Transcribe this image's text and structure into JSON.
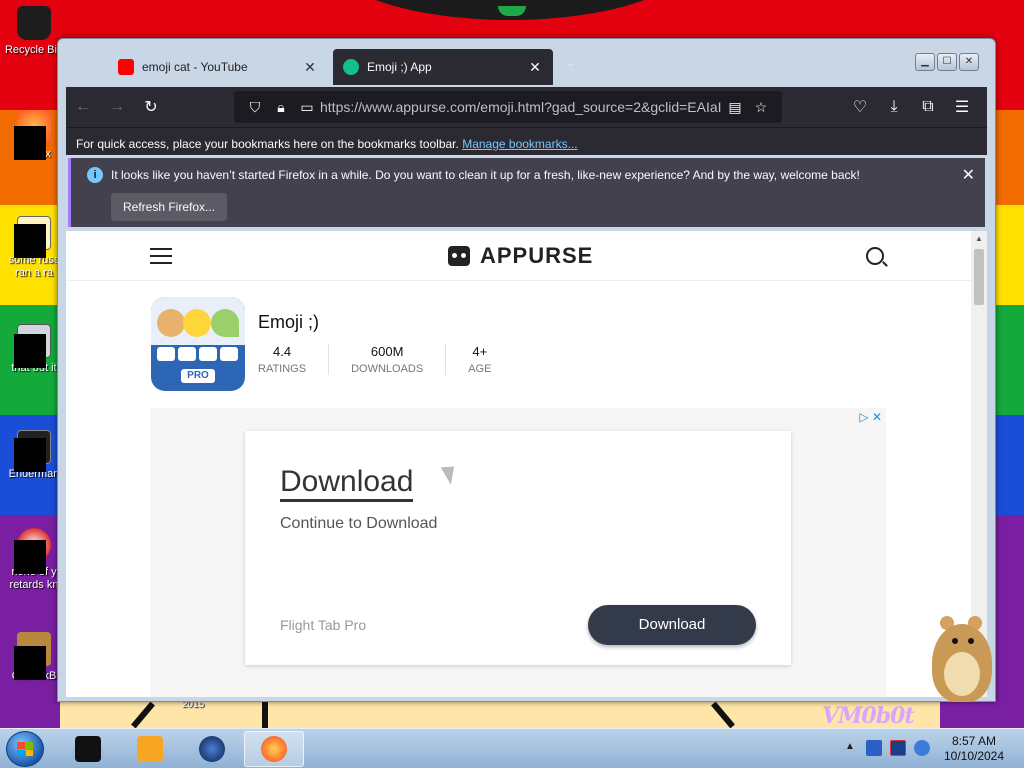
{
  "desktop": {
    "icons": [
      {
        "label": "Recycle Bin",
        "icon": "recycle-bin-icon"
      },
      {
        "label": "Firefox",
        "icon": "firefox-icon"
      },
      {
        "label": "some russ",
        "label2": "ran a ra",
        "icon": "document-icon"
      },
      {
        "label": "that but it",
        "icon": "folder-icon"
      },
      {
        "label": "Enderman",
        "icon": "console-icon"
      },
      {
        "label": "none of y",
        "label2": "retards kn",
        "icon": "browser-icon"
      },
      {
        "label": "ChomikB",
        "icon": "hamster-icon"
      }
    ],
    "wallpaper_year": "2015",
    "wallpaper_tag": "VM0b0t"
  },
  "browser": {
    "tabs": [
      {
        "title": "emoji cat - YouTube",
        "favicon": "youtube-icon",
        "favicon_color": "#ff0000"
      },
      {
        "title": "Emoji ;) App",
        "favicon": "appurse-icon",
        "favicon_color": "#13c08a",
        "active": true
      }
    ],
    "new_tab_label": "+",
    "url": "https://www.appurse.com/emoji.html?gad_source=2&gclid=EAIaI",
    "bookmarks_bar": {
      "text": "For quick access, place your bookmarks here on the bookmarks toolbar.",
      "link": "Manage bookmarks..."
    },
    "notification": {
      "message": "It looks like you haven’t started Firefox in a while. Do you want to clean it up for a fresh, like-new experience? And by the way, welcome back!",
      "button": "Refresh Firefox..."
    }
  },
  "page": {
    "site_name": "APPURSE",
    "app": {
      "name": "Emoji ;)",
      "icon_badge": "PRO",
      "stats": [
        {
          "value": "4.4",
          "label": "RATINGS"
        },
        {
          "value": "600M",
          "label": "DOWNLOADS"
        },
        {
          "value": "4+",
          "label": "AGE"
        }
      ]
    },
    "ad": {
      "title": "Download",
      "subtitle": "Continue to Download",
      "brand": "Flight Tab Pro",
      "button": "Download"
    }
  },
  "taskbar": {
    "time": "8:57 AM",
    "date": "10/10/2024"
  },
  "colors": {
    "firefox_toolbar": "#2b2a33",
    "notification_bg": "#42414d",
    "link": "#75c8ff",
    "ad_button": "#333a4a"
  }
}
